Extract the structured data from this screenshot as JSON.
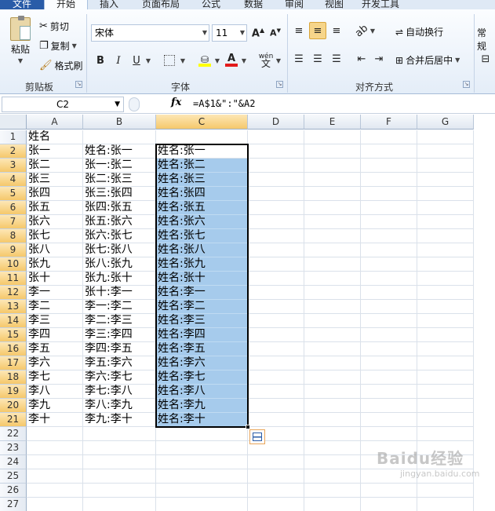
{
  "ribbon": {
    "tabs": [
      "文件",
      "开始",
      "插入",
      "页面布局",
      "公式",
      "数据",
      "审阅",
      "视图",
      "开发工具"
    ],
    "active_tab": "开始",
    "clipboard": {
      "paste": "粘贴",
      "cut": "剪切",
      "copy": "复制",
      "format_painter": "格式刷",
      "label": "剪贴板"
    },
    "font": {
      "family": "宋体",
      "size": "11",
      "bold": "B",
      "italic": "I",
      "underline": "U",
      "phonetic": "wén",
      "label": "字体"
    },
    "alignment": {
      "wrap_text": "自动换行",
      "merge_center": "合并后居中",
      "label": "对齐方式"
    },
    "number": {
      "format": "常规"
    }
  },
  "formula_bar": {
    "name_box": "C2",
    "fx": "fx",
    "formula": "=A$1&\":\"&A2"
  },
  "sheet": {
    "columns": [
      "A",
      "B",
      "C",
      "D",
      "E",
      "F",
      "G"
    ],
    "rows": [
      "1",
      "2",
      "3",
      "4",
      "5",
      "6",
      "7",
      "8",
      "9",
      "10",
      "11",
      "12",
      "13",
      "14",
      "15",
      "16",
      "17",
      "18",
      "19",
      "20",
      "21",
      "22",
      "23",
      "24",
      "25",
      "26",
      "27"
    ],
    "col_a": [
      "姓名",
      "张一",
      "张二",
      "张三",
      "张四",
      "张五",
      "张六",
      "张七",
      "张八",
      "张九",
      "张十",
      "李一",
      "李二",
      "李三",
      "李四",
      "李五",
      "李六",
      "李七",
      "李八",
      "李九",
      "李十"
    ],
    "col_b": [
      "",
      "姓名:张一",
      "张一:张二",
      "张二:张三",
      "张三:张四",
      "张四:张五",
      "张五:张六",
      "张六:张七",
      "张七:张八",
      "张八:张九",
      "张九:张十",
      "张十:李一",
      "李一:李二",
      "李二:李三",
      "李三:李四",
      "李四:李五",
      "李五:李六",
      "李六:李七",
      "李七:李八",
      "李八:李九",
      "李九:李十"
    ],
    "col_c": [
      "",
      "姓名:张一",
      "姓名:张二",
      "姓名:张三",
      "姓名:张四",
      "姓名:张五",
      "姓名:张六",
      "姓名:张七",
      "姓名:张八",
      "姓名:张九",
      "姓名:张十",
      "姓名:李一",
      "姓名:李二",
      "姓名:李三",
      "姓名:李四",
      "姓名:李五",
      "姓名:李六",
      "姓名:李七",
      "姓名:李八",
      "姓名:李九",
      "姓名:李十"
    ],
    "selected_column": "C",
    "selection": "C2:C21",
    "selection_color": "#a6cbec"
  },
  "watermark": {
    "text": "Baidu经验",
    "sub": "jingyan.baidu.com"
  }
}
